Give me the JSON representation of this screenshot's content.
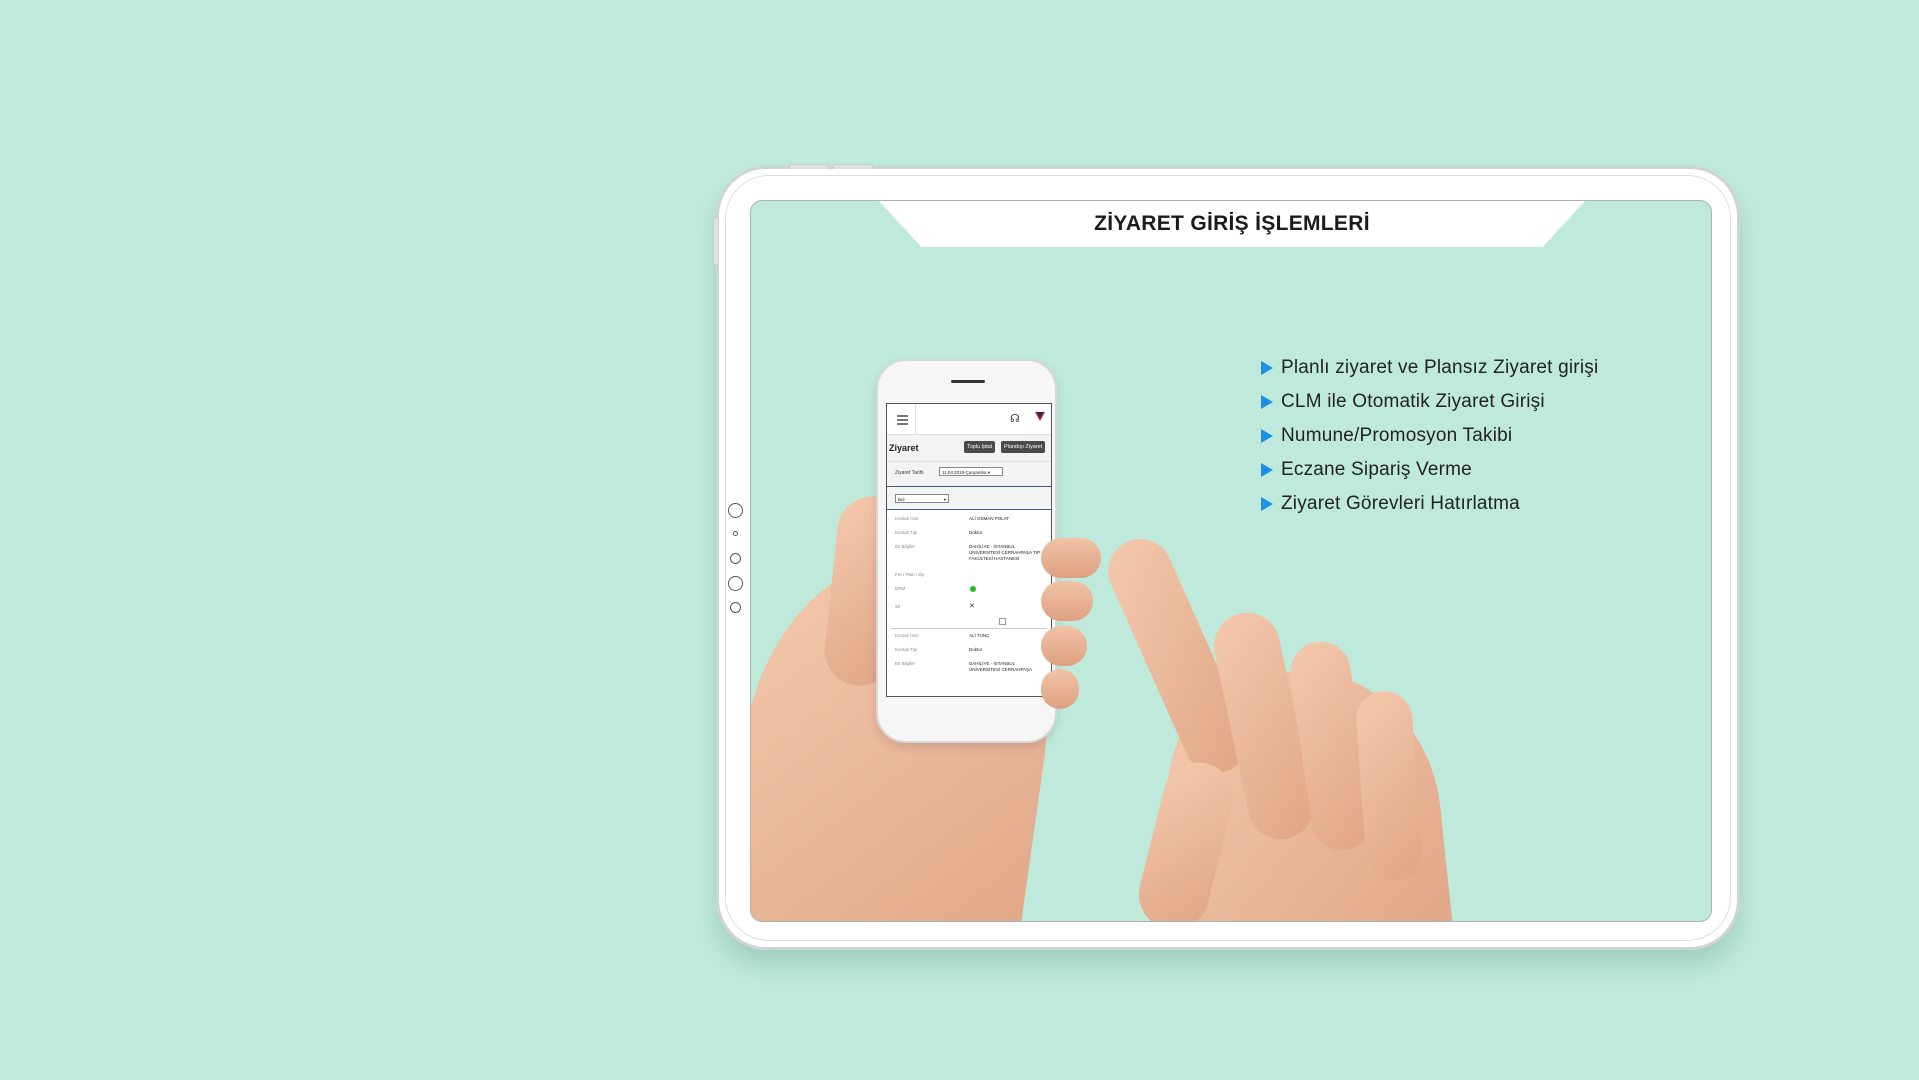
{
  "title": "ZİYARET GİRİŞ İŞLEMLERİ",
  "features": [
    "Planlı ziyaret ve Plansız Ziyaret girişi",
    "CLM ile Otomatik Ziyaret Girişi",
    "Numune/Promosyon Takibi",
    "Eczane Sipariş Verme",
    "Ziyaret Görevleri Hatırlatma"
  ],
  "colors": {
    "background": "#bfeadb",
    "arrow": "#1a8fe3",
    "status_dot": "#22bb22"
  },
  "phone_app": {
    "icons": {
      "menu": "hamburger-icon",
      "support": "headset-icon",
      "logo": "brand-logo"
    },
    "page_title": "Ziyaret",
    "buttons": {
      "bulk_cancel": "Toplu İptal",
      "unplanned_visit": "Plandışı Ziyaret"
    },
    "date_label": "Ziyaret Tarihi",
    "date_value": "11.04.2018-Çarşamba",
    "filter_value": "Bul",
    "records": [
      {
        "contact_name_label": "Kontak İsmi",
        "contact_name": "ALİ OSMAN POLAT",
        "contact_type_label": "Kontak Tipi",
        "contact_type": "Doktor",
        "extra_label": "Ek Bilgiler",
        "extra": "DAHİLİYE - İSTANBUL ÜNİVERSİTESİ CERRAHPAŞA TIP FAKÜLTESİ HASTANESİ",
        "freq_label": "Fre / Plan / Ziy",
        "status_label": "DRM",
        "delete_label": "Sil"
      },
      {
        "contact_name_label": "Kontak İsmi",
        "contact_name": "ALİ TUNÇ",
        "contact_type_label": "Kontak Tipi",
        "contact_type": "Doktor",
        "extra_label": "Ek Bilgiler",
        "extra": "DAHİLİYE - İSTANBUL ÜNİVERSİTESİ CERRAHPAŞA"
      }
    ]
  }
}
